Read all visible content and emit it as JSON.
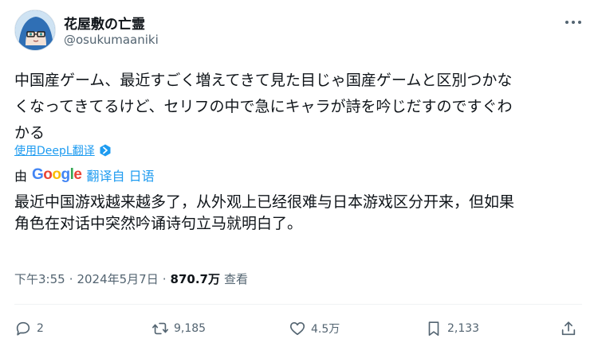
{
  "user": {
    "display_name": "花屋敷の亡霊",
    "handle": "@osukumaaniki"
  },
  "tweet": {
    "lines": [
      "中国産ゲーム、最近すごく増えてきて見た目じゃ国産ゲームと区別つかな",
      "くなってきてるけど、セリフの中で急にキャラが詩を吟じだすのですぐわ",
      "かる"
    ]
  },
  "deepl": {
    "label": "使用DeepL翻译"
  },
  "translation": {
    "by_label": "由",
    "google_letters": [
      {
        "ch": "G",
        "color": "#4285F4"
      },
      {
        "ch": "o",
        "color": "#EA4335"
      },
      {
        "ch": "o",
        "color": "#FBBC05"
      },
      {
        "ch": "g",
        "color": "#4285F4"
      },
      {
        "ch": "l",
        "color": "#34A853"
      },
      {
        "ch": "e",
        "color": "#EA4335"
      }
    ],
    "from_label": "翻译自 日语",
    "lines": [
      "最近中国游戏越来越多了，从外观上已经很难与日本游戏区分开来，但如果",
      "角色在对话中突然吟诵诗句立马就明白了。"
    ]
  },
  "meta": {
    "time": "下午3:55",
    "separator": "·",
    "date": "2024年5月7日",
    "views_count": "870.7万",
    "views_label": "查看"
  },
  "actions": {
    "replies": "2",
    "retweets": "9,185",
    "likes": "4.5万",
    "bookmarks": "2,133"
  },
  "colors": {
    "accent": "#1d9bf0",
    "text": "#0f1419",
    "secondary": "#536471"
  },
  "icons": [
    "more-icon",
    "deepl-verified-icon",
    "reply-icon",
    "retweet-icon",
    "like-icon",
    "bookmark-icon",
    "share-icon"
  ]
}
